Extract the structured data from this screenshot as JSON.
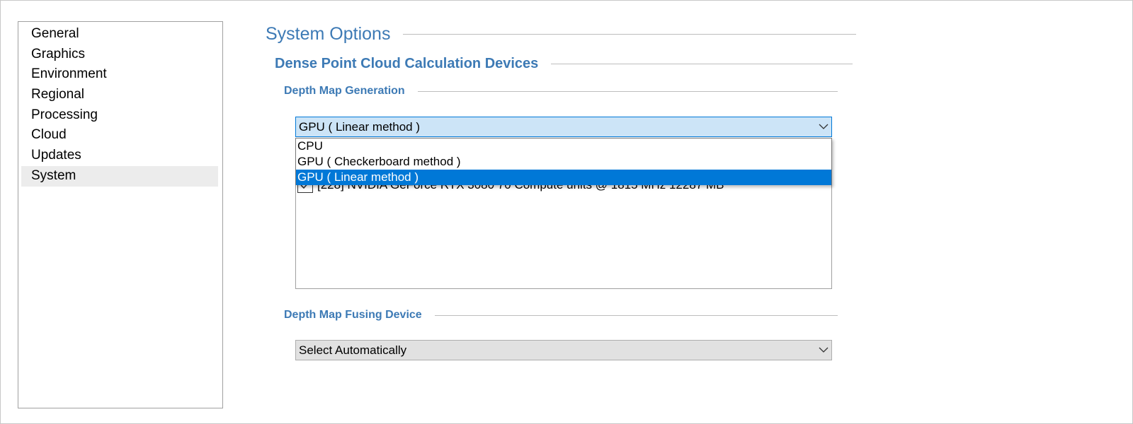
{
  "sidebar": {
    "items": [
      {
        "label": "General"
      },
      {
        "label": "Graphics"
      },
      {
        "label": "Environment"
      },
      {
        "label": "Regional"
      },
      {
        "label": "Processing"
      },
      {
        "label": "Cloud"
      },
      {
        "label": "Updates"
      },
      {
        "label": "System"
      }
    ],
    "selected": "System"
  },
  "main": {
    "title": "System Options",
    "section": "Dense Point Cloud Calculation Devices",
    "depth_map_generation": {
      "heading": "Depth Map Generation",
      "selected_value": "GPU ( Linear method )",
      "options": [
        {
          "label": "CPU"
        },
        {
          "label": "GPU ( Checkerboard method )"
        },
        {
          "label": "GPU ( Linear method )"
        }
      ],
      "device": {
        "label": "[228] NVIDIA GeForce RTX 3080 70 Compute units @ 1815 MHz 12287 MB",
        "checked": true
      }
    },
    "depth_map_fusing": {
      "heading": "Depth Map Fusing Device",
      "selected_value": "Select Automatically"
    }
  },
  "colors": {
    "heading": "#3d7ab5",
    "selection": "#0078d7",
    "combo_open": "#cce4f7",
    "combo_closed": "#e1e1e1"
  },
  "icons": [
    "chevron-down-icon",
    "checkmark-icon"
  ]
}
